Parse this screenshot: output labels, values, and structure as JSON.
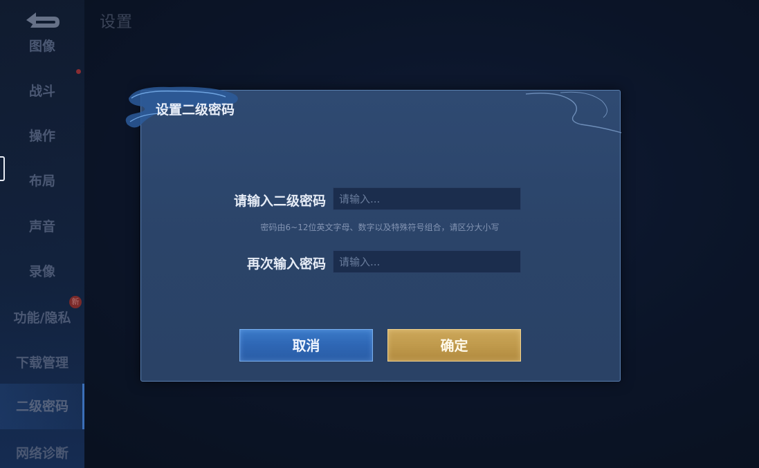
{
  "header": {
    "title": "设置"
  },
  "sidebar": {
    "items": [
      {
        "label": "图像"
      },
      {
        "label": "战斗"
      },
      {
        "label": "操作"
      },
      {
        "label": "布局"
      },
      {
        "label": "声音"
      },
      {
        "label": "录像"
      },
      {
        "label": "功能/隐私"
      },
      {
        "label": "下载管理"
      },
      {
        "label": "二级密码"
      },
      {
        "label": "网络诊断"
      }
    ],
    "active_item": "二级密码",
    "new_badge": "新"
  },
  "dialog": {
    "title": "设置二级密码",
    "password_label": "请输入二级密码",
    "password_placeholder": "请输入...",
    "hint": "密码由6~12位英文字母、数字以及特殊符号组合，请区分大小写",
    "confirm_label": "再次输入密码",
    "confirm_placeholder": "请输入...",
    "cancel_button": "取消",
    "ok_button": "确定"
  },
  "icons": {
    "back": "back-arrow-icon"
  },
  "colors": {
    "cancel_button": "#2e66b4",
    "confirm_button": "#c09a4c",
    "dialog_bg": "#2b4469"
  }
}
